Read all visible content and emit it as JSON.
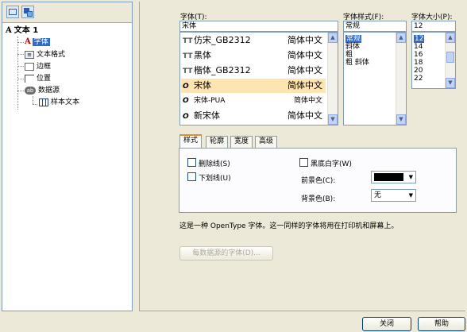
{
  "tree": {
    "root_label": "文本 1",
    "items": [
      {
        "label": "字体",
        "icon": "font-color-icon",
        "selected": true
      },
      {
        "label": "文本格式",
        "icon": "text-format-icon"
      },
      {
        "label": "边框",
        "icon": "border-icon"
      },
      {
        "label": "位置",
        "icon": "position-icon"
      },
      {
        "label": "数据源",
        "icon": "datasource-icon"
      },
      {
        "label": "样本文本",
        "icon": "grid-icon"
      }
    ]
  },
  "font": {
    "label": "字体(T):",
    "value": "宋体",
    "list": [
      {
        "type": "TT",
        "name": "仿宋_GB2312",
        "sample": "简体中文"
      },
      {
        "type": "TT",
        "name": "黑体",
        "sample": "简体中文"
      },
      {
        "type": "TT",
        "name": "楷体_GB2312",
        "sample": "简体中文"
      },
      {
        "type": "O",
        "name": "宋体",
        "sample": "简体中文"
      },
      {
        "type": "O",
        "name": "宋体-PUA",
        "sample": "简体中文"
      },
      {
        "type": "O",
        "name": "新宋体",
        "sample": "简体中文"
      }
    ]
  },
  "style": {
    "label": "字体样式(F):",
    "value": "常规",
    "options": [
      "常规",
      "斜体",
      "粗",
      "粗 斜体"
    ]
  },
  "size": {
    "label": "字体大小(P):",
    "value": "12",
    "options": [
      "12",
      "14",
      "16",
      "18",
      "20",
      "22"
    ]
  },
  "tabs": [
    "样式",
    "轮廓",
    "宽度",
    "高级"
  ],
  "style_tab": {
    "strikethrough": "删除线(S)",
    "underline": "下划线(U)",
    "white_on_black": "黑底白字(W)",
    "foreground_label": "前景色(C):",
    "foreground_color": "#000000",
    "background_label": "背景色(B):",
    "background_value": "无"
  },
  "description": "这是一种 OpenType 字体。这一同样的字体将用在打印机和屏幕上。",
  "per_datasource_button": "每数据源的字体(D)...",
  "footer": {
    "close": "关闭",
    "help": "帮助"
  },
  "colors": {
    "selection": "#316ac5",
    "font_row_highlight": "#fde4b0",
    "tab_accent": "#e68b2c"
  }
}
